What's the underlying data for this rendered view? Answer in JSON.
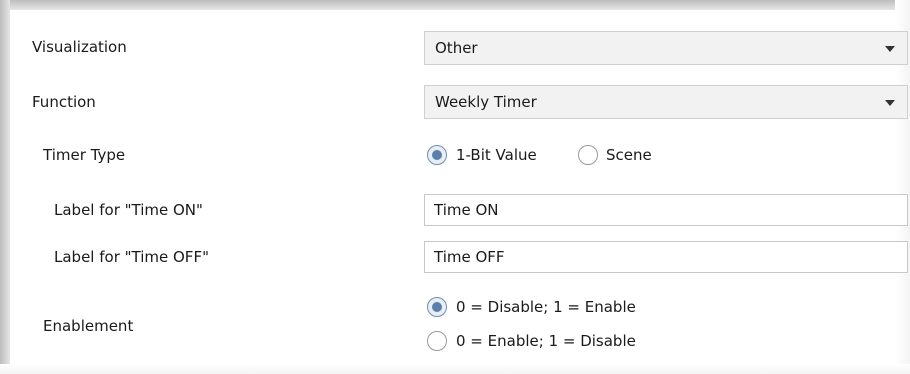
{
  "rows": {
    "visualization": {
      "label": "Visualization",
      "value": "Other"
    },
    "function": {
      "label": "Function",
      "value": "Weekly Timer"
    },
    "timer_type": {
      "label": "Timer Type",
      "options": [
        "1-Bit Value",
        "Scene"
      ],
      "selected": "1-Bit Value"
    },
    "label_time_on": {
      "label": "Label for \"Time ON\"",
      "value": "Time ON"
    },
    "label_time_off": {
      "label": "Label for \"Time OFF\"",
      "value": "Time OFF"
    },
    "enablement": {
      "label": "Enablement",
      "options": [
        "0 = Disable; 1 = Enable",
        "0 = Enable; 1 = Disable"
      ],
      "selected": "0 = Disable; 1 = Enable"
    }
  },
  "colors": {
    "radio_selected": "#5b7fa9",
    "dropdown_background": "#f2f2f2"
  },
  "icons": {
    "dropdown_arrow": "chevron-down-icon"
  }
}
